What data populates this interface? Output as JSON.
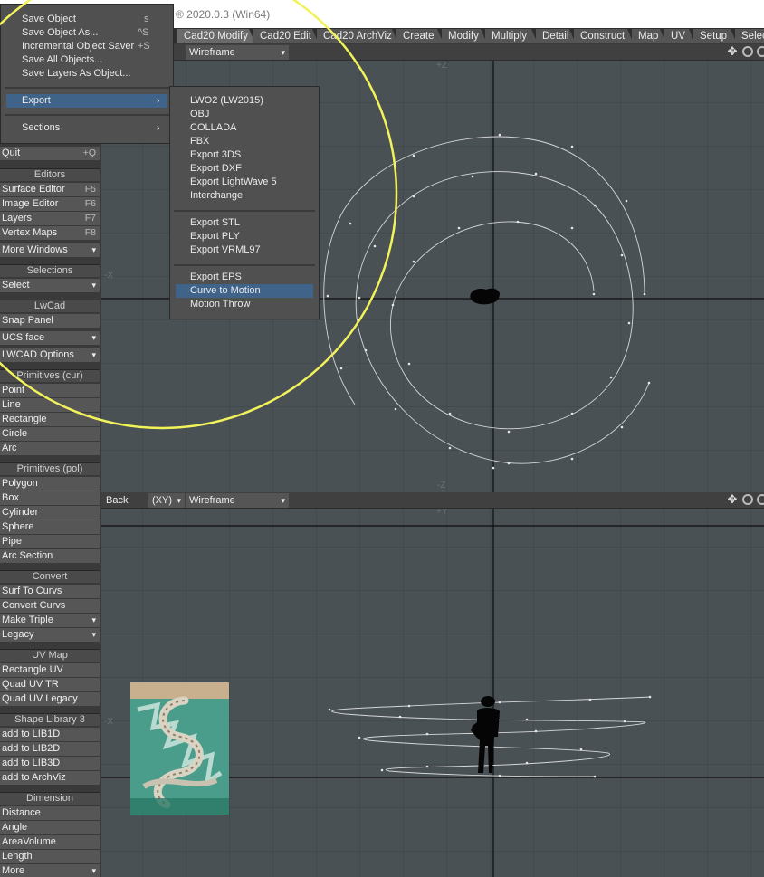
{
  "title_bar": {
    "version_text": "® 2020.0.3 (Win64)"
  },
  "tabs": [
    "Cad20 Modify",
    "Cad20 Edit",
    "Cad20 ArchViz",
    "Create",
    "Modify",
    "Multiply",
    "Detail",
    "Construct",
    "Map",
    "UV",
    "Setup",
    "Select"
  ],
  "active_tab": "Cad20 Modify",
  "viewports": {
    "top": {
      "render_mode": "Wireframe",
      "axis_top": "+Z",
      "axis_bottom": "-Z",
      "axis_left": "-X"
    },
    "back": {
      "view_name": "Back",
      "axes": "(XY)",
      "render_mode": "Wireframe",
      "axis_top": "+Y",
      "axis_left": "-X"
    }
  },
  "file_menu": {
    "items": [
      {
        "label": "Save Object",
        "shortcut": "s"
      },
      {
        "label": "Save Object As...",
        "shortcut": "^S"
      },
      {
        "label": "Incremental Object Saver",
        "shortcut": "+S"
      },
      {
        "label": "Save All Objects...",
        "shortcut": ""
      },
      {
        "label": "Save Layers As Object...",
        "shortcut": ""
      }
    ],
    "export": "Export",
    "sections": "Sections"
  },
  "export_menu": {
    "group1": [
      "LWO2 (LW2015)",
      "OBJ",
      "COLLADA",
      "FBX",
      "Export 3DS",
      "Export DXF",
      "Export LightWave 5",
      "Interchange"
    ],
    "group2": [
      "Export STL",
      "Export PLY",
      "Export VRML97"
    ],
    "group3": [
      "Export EPS",
      "Curve to Motion",
      "Motion Throw"
    ],
    "highlighted": "Curve to Motion"
  },
  "sidebar": {
    "quit": {
      "label": "Quit",
      "shortcut": "+Q"
    },
    "editors": {
      "title": "Editors",
      "items": [
        {
          "label": "Surface Editor",
          "shortcut": "F5"
        },
        {
          "label": "Image Editor",
          "shortcut": "F6"
        },
        {
          "label": "Layers",
          "shortcut": "F7"
        },
        {
          "label": "Vertex Maps",
          "shortcut": "F8"
        }
      ],
      "more": "More Windows"
    },
    "selections": {
      "title": "Selections",
      "select": "Select"
    },
    "lwcad": {
      "title": "LwCad",
      "items": [
        "Snap Panel",
        "UCS face",
        "LWCAD Options"
      ]
    },
    "prim_cur": {
      "title": "Primitives (cur)",
      "items": [
        "Point",
        "Line",
        "Rectangle",
        "Circle",
        "Arc"
      ]
    },
    "prim_pol": {
      "title": "Primitives (pol)",
      "items": [
        "Polygon",
        "Box",
        "Cylinder",
        "Sphere",
        "Pipe",
        "Arc Section"
      ]
    },
    "convert": {
      "title": "Convert",
      "items": [
        "Surf To Curvs",
        "Convert Curvs",
        "Make Triple",
        "Legacy"
      ]
    },
    "uvmap": {
      "title": "UV Map",
      "items": [
        "Rectangle UV",
        "Quad UV TR",
        "Quad UV Legacy"
      ]
    },
    "shapelib": {
      "title": "Shape Library 3",
      "items": [
        "add to LIB1D",
        "add to LIB2D",
        "add to LIB3D",
        "add to ArchViz"
      ]
    },
    "dimension": {
      "title": "Dimension",
      "items": [
        "Distance",
        "Angle",
        "AreaVolume",
        "Length",
        "More"
      ]
    }
  }
}
